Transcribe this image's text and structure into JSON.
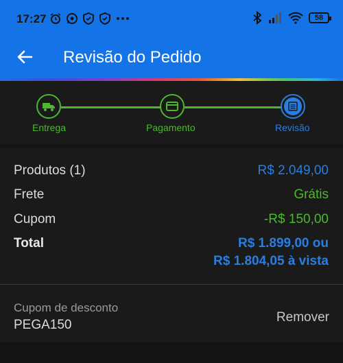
{
  "status_bar": {
    "time": "17:27",
    "left_icons": [
      "alarm-icon",
      "whatsapp-icon",
      "shield-icon",
      "shield-icon",
      "more-dots-icon"
    ],
    "right_icons": [
      "bluetooth-icon",
      "signal-icon",
      "wifi-icon"
    ],
    "battery": "58"
  },
  "header": {
    "title": "Revisão do Pedido",
    "back_icon": "arrow-left-icon"
  },
  "stepper": {
    "steps": [
      {
        "label": "Entrega",
        "icon": "truck-icon",
        "state": "completed"
      },
      {
        "label": "Pagamento",
        "icon": "card-icon",
        "state": "completed"
      },
      {
        "label": "Revisão",
        "icon": "list-icon",
        "state": "current"
      }
    ]
  },
  "summary": {
    "products_label": "Produtos (1)",
    "products_value": "R$ 2.049,00",
    "shipping_label": "Frete",
    "shipping_value": "Grátis",
    "coupon_label": "Cupom",
    "coupon_value": "-R$ 150,00",
    "total_label": "Total",
    "total_value_line1": "R$ 1.899,00 ou",
    "total_value_line2": "R$ 1.804,05 à vista"
  },
  "coupon": {
    "caption": "Cupom de desconto",
    "code": "PEGA150",
    "remove_label": "Remover"
  },
  "colors": {
    "appbar": "#1473e6",
    "accent_blue": "#2a7de1",
    "accent_green": "#4cb82e",
    "background": "#1a1a1a"
  }
}
